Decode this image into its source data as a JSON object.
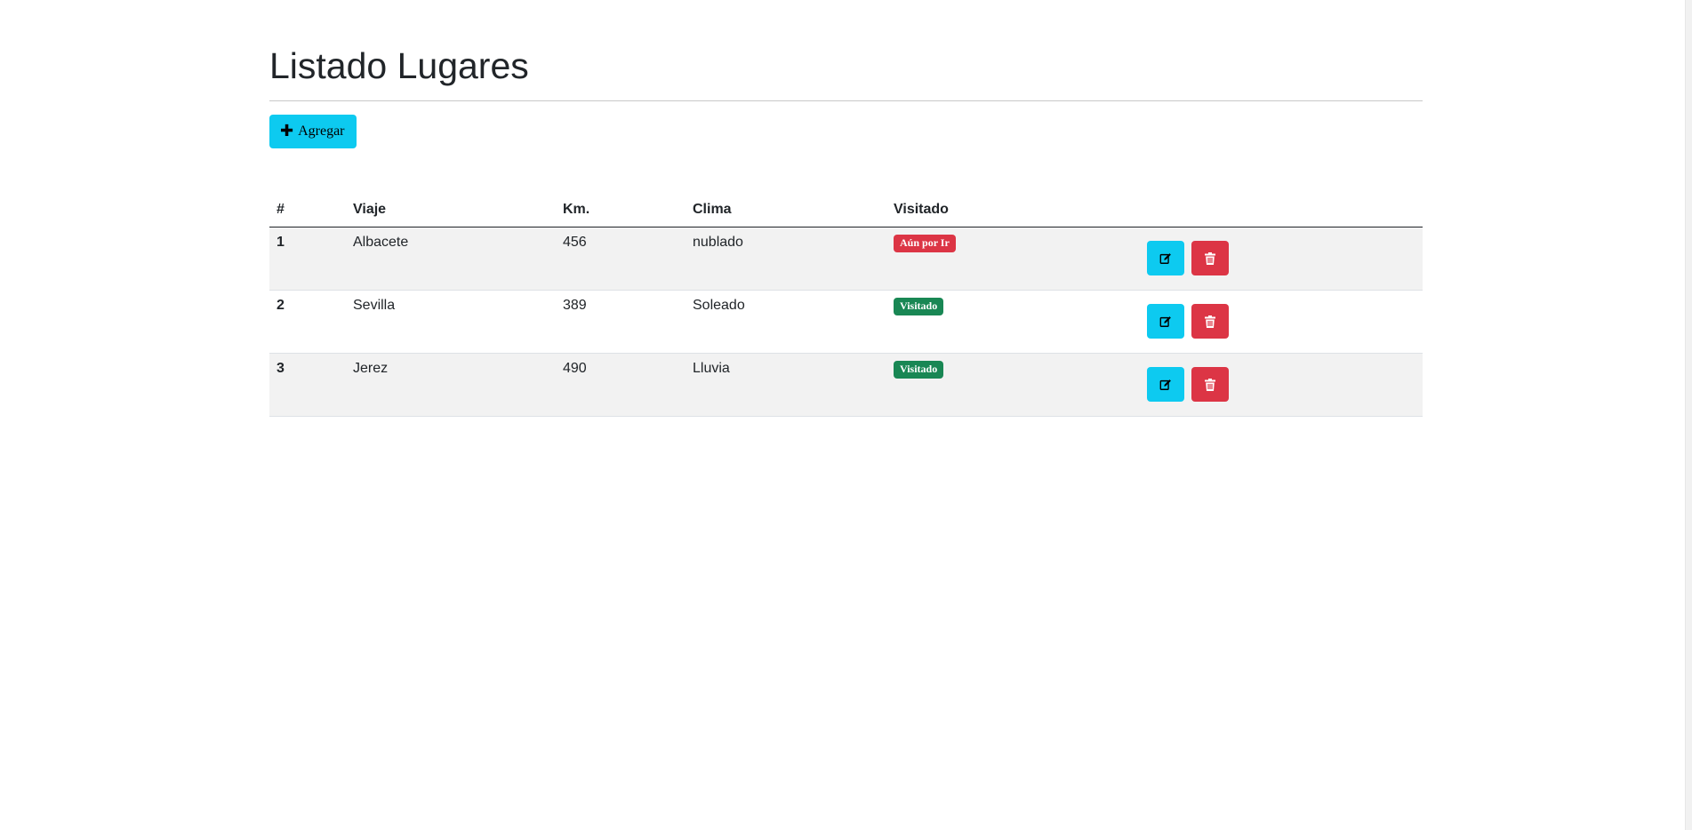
{
  "page": {
    "title": "Listado Lugares"
  },
  "toolbar": {
    "add_icon": "plus-icon",
    "add_label": "Agregar"
  },
  "table": {
    "headers": [
      "#",
      "Viaje",
      "Km.",
      "Clima",
      "Visitado",
      ""
    ],
    "rows": [
      {
        "num": "1",
        "viaje": "Albacete",
        "km": "456",
        "clima": "nublado",
        "status": "Aún por Ir",
        "status_color": "#dc3545"
      },
      {
        "num": "2",
        "viaje": "Sevilla",
        "km": "389",
        "clima": "Soleado",
        "status": "Visitado",
        "status_color": "#198754"
      },
      {
        "num": "3",
        "viaje": "Jerez",
        "km": "490",
        "clima": "Lluvia",
        "status": "Visitado",
        "status_color": "#198754"
      }
    ],
    "row_actions": {
      "edit_icon": "edit-icon",
      "delete_icon": "trash-icon"
    }
  },
  "colors": {
    "accent": "#0dcaf0",
    "danger": "#dc3545",
    "success": "#198754",
    "stripe": "#f2f2f2"
  }
}
